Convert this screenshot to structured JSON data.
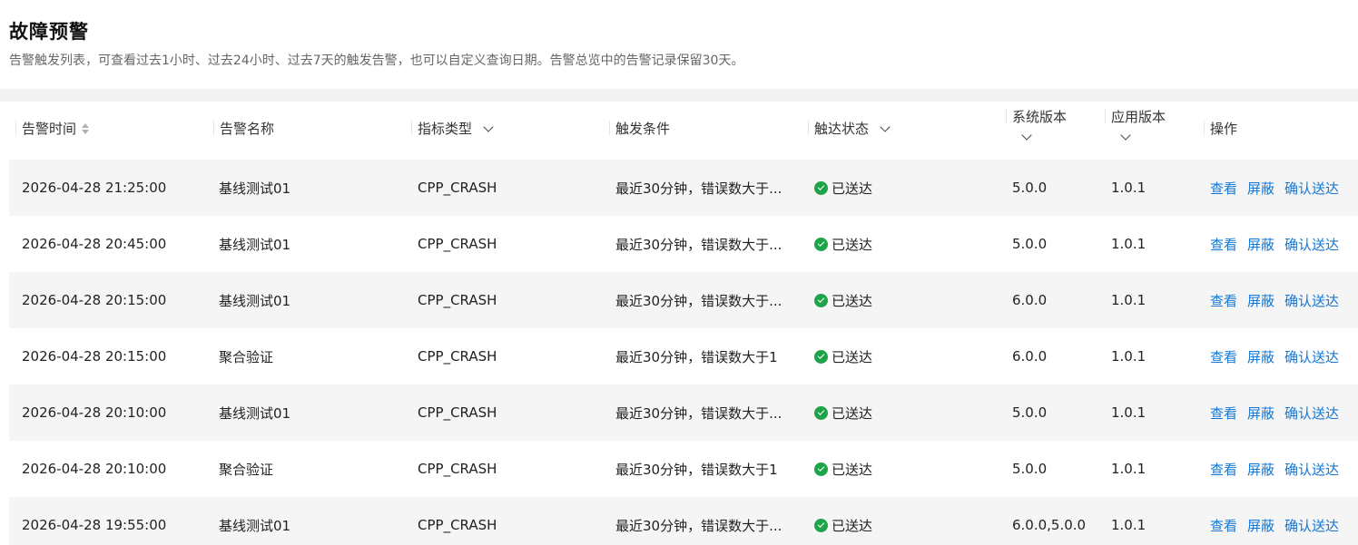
{
  "page": {
    "title": "故障预警",
    "description": "告警触发列表，可查看过去1小时、过去24小时、过去7天的触发告警，也可以自定义查询日期。告警总览中的告警记录保留30天。"
  },
  "table": {
    "columns": {
      "time": "告警时间",
      "name": "告警名称",
      "metric": "指标类型",
      "condition": "触发条件",
      "status": "触达状态",
      "sys_version": "系统版本",
      "app_version": "应用版本",
      "actions": "操作"
    },
    "action_labels": {
      "view": "查看",
      "block": "屏蔽",
      "confirm": "确认送达"
    },
    "status_color": "#1fa34a",
    "link_color": "#1677d2",
    "rows": [
      {
        "time": "2026-04-28 21:25:00",
        "name": "基线测试01",
        "metric": "CPP_CRASH",
        "condition": "最近30分钟，错误数大于...",
        "status": "已送达",
        "sys_version": "5.0.0",
        "app_version": "1.0.1"
      },
      {
        "time": "2026-04-28 20:45:00",
        "name": "基线测试01",
        "metric": "CPP_CRASH",
        "condition": "最近30分钟，错误数大于...",
        "status": "已送达",
        "sys_version": "5.0.0",
        "app_version": "1.0.1"
      },
      {
        "time": "2026-04-28 20:15:00",
        "name": "基线测试01",
        "metric": "CPP_CRASH",
        "condition": "最近30分钟，错误数大于...",
        "status": "已送达",
        "sys_version": "6.0.0",
        "app_version": "1.0.1"
      },
      {
        "time": "2026-04-28 20:15:00",
        "name": "聚合验证",
        "metric": "CPP_CRASH",
        "condition": "最近30分钟，错误数大于1",
        "status": "已送达",
        "sys_version": "6.0.0",
        "app_version": "1.0.1"
      },
      {
        "time": "2026-04-28 20:10:00",
        "name": "基线测试01",
        "metric": "CPP_CRASH",
        "condition": "最近30分钟，错误数大于...",
        "status": "已送达",
        "sys_version": "5.0.0",
        "app_version": "1.0.1"
      },
      {
        "time": "2026-04-28 20:10:00",
        "name": "聚合验证",
        "metric": "CPP_CRASH",
        "condition": "最近30分钟，错误数大于1",
        "status": "已送达",
        "sys_version": "5.0.0",
        "app_version": "1.0.1"
      },
      {
        "time": "2026-04-28 19:55:00",
        "name": "基线测试01",
        "metric": "CPP_CRASH",
        "condition": "最近30分钟，错误数大于...",
        "status": "已送达",
        "sys_version": "6.0.0,5.0.0",
        "app_version": "1.0.1"
      }
    ]
  }
}
